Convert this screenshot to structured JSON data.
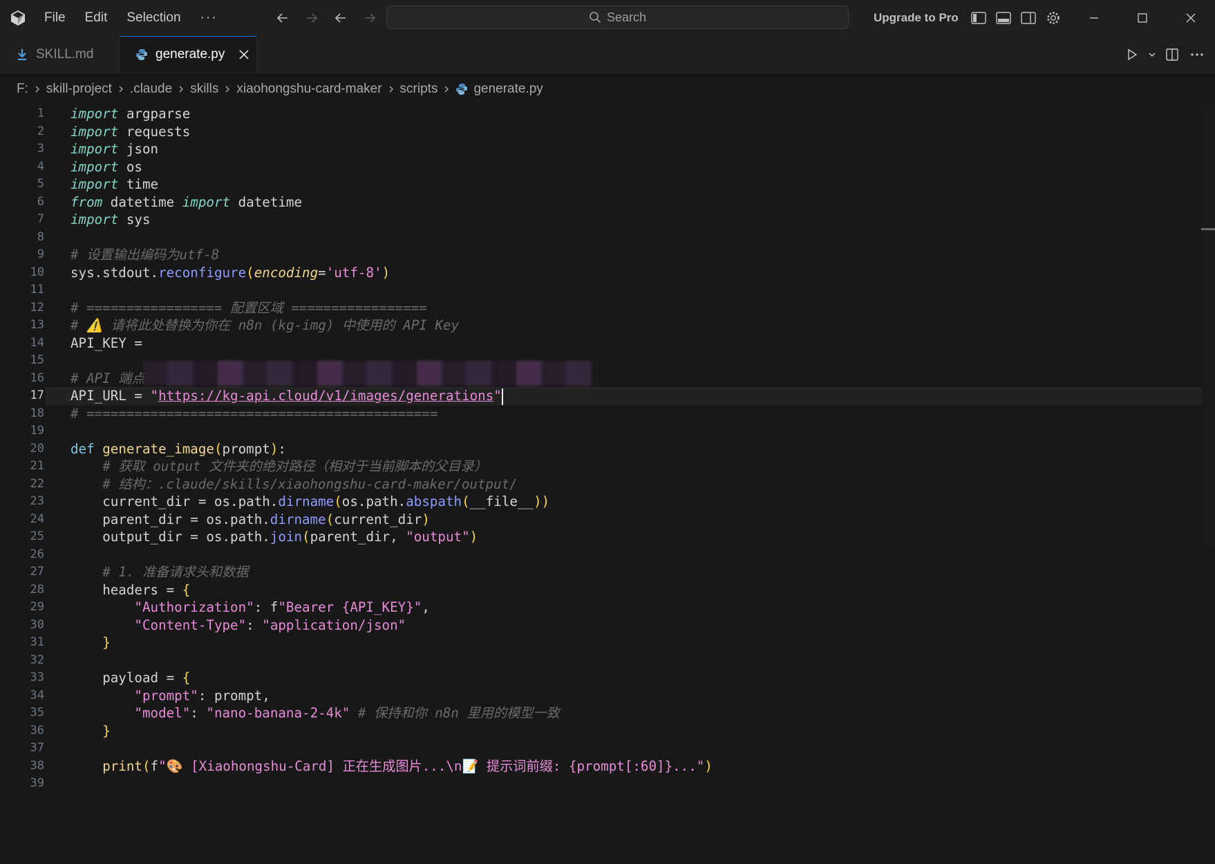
{
  "titlebar": {
    "menu": [
      "File",
      "Edit",
      "Selection",
      "···"
    ],
    "search_placeholder": "Search",
    "upgrade_label": "Upgrade to Pro"
  },
  "tabs": [
    {
      "label": "SKILL.md",
      "active": false
    },
    {
      "label": "generate.py",
      "active": true
    }
  ],
  "breadcrumb": [
    "F:",
    "skill-project",
    ".claude",
    "skills",
    "xiaohongshu-card-maker",
    "scripts",
    "generate.py"
  ],
  "editor": {
    "current_line": 17,
    "lines": [
      "import argparse",
      "import requests",
      "import json",
      "import os",
      "import time",
      "from datetime import datetime",
      "import sys",
      "",
      "# 设置输出编码为utf-8",
      "sys.stdout.reconfigure(encoding='utf-8')",
      "",
      "# ================= 配置区域 =================",
      "# ⚠️ 请将此处替换为你在 n8n (kg-img) 中使用的 API Key",
      "API_KEY = ",
      "",
      "# API 端点",
      "API_URL = \"https://kg-api.cloud/v1/images/generations\"",
      "# ============================================",
      "",
      "def generate_image(prompt):",
      "    # 获取 output 文件夹的绝对路径（相对于当前脚本的父目录）",
      "    # 结构：.claude/skills/xiaohongshu-card-maker/output/",
      "    current_dir = os.path.dirname(os.path.abspath(__file__))",
      "    parent_dir = os.path.dirname(current_dir)",
      "    output_dir = os.path.join(parent_dir, \"output\")",
      "",
      "    # 1. 准备请求头和数据",
      "    headers = {",
      "        \"Authorization\": f\"Bearer {API_KEY}\",",
      "        \"Content-Type\": \"application/json\"",
      "    }",
      "",
      "    payload = {",
      "        \"prompt\": prompt,",
      "        \"model\": \"nano-banana-2-4k\" # 保持和你 n8n 里用的模型一致",
      "    }",
      "",
      "    print(f\"🎨 [Xiaohongshu-Card] 正在生成图片...\\n📝 提示词前缀: {prompt[:60]}...\")",
      ""
    ]
  },
  "colors": {
    "background": "#181818",
    "titlebar": "#1f1f1f",
    "accent": "#0078d4",
    "python_icon": "#4b8bbe"
  }
}
